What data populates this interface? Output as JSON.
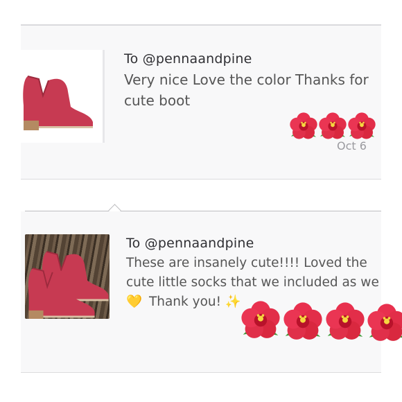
{
  "messages": [
    {
      "recipient": "To @pennaandpine",
      "body": "Very nice Love the color Thanks for cute boot",
      "date": "Oct 6"
    },
    {
      "recipient": "To @pennaandpine",
      "body_line1": "These are insanely cute!!!! Loved the",
      "body_line2": "cute little socks that we included as we",
      "heart": "💛",
      "thanks": "Thank you!",
      "sparkle": "✨"
    }
  ],
  "colors": {
    "card_bg": "#f8f8f9",
    "boot_red": "#c73a52",
    "hibiscus": "#e8304e"
  },
  "icons": [
    "hibiscus-icon",
    "yellow-heart-icon",
    "sparkles-icon"
  ]
}
